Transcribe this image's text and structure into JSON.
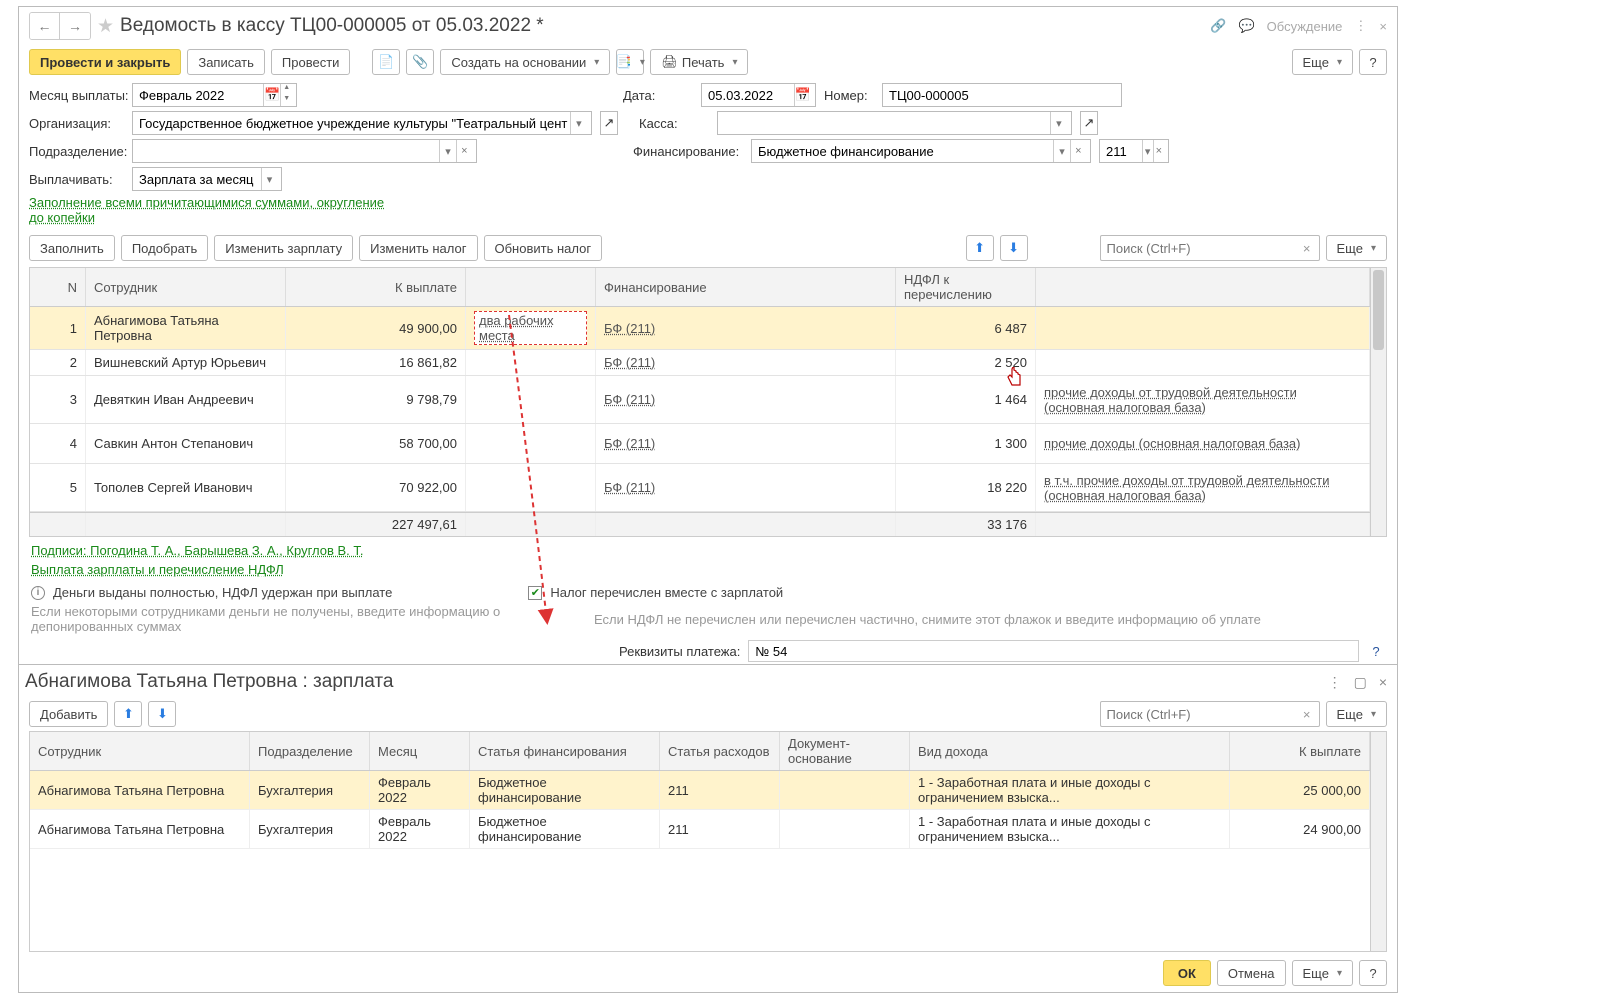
{
  "header": {
    "title": "Ведомость в кассу ТЦ00-000005 от 05.03.2022 *",
    "discussion": "Обсуждение"
  },
  "toolbar": {
    "post_close": "Провести и закрыть",
    "save": "Записать",
    "post": "Провести",
    "create_based": "Создать на основании",
    "print": "Печать",
    "more": "Еще"
  },
  "form": {
    "month_lbl": "Месяц выплаты:",
    "month_val": "Февраль 2022",
    "date_lbl": "Дата:",
    "date_val": "05.03.2022",
    "num_lbl": "Номер:",
    "num_val": "ТЦ00-000005",
    "org_lbl": "Организация:",
    "org_val": "Государственное бюджетное учреждение культуры \"Театральный центр\"",
    "cash_lbl": "Касса:",
    "cash_val": "",
    "dep_lbl": "Подразделение:",
    "dep_val": "",
    "fin_lbl": "Финансирование:",
    "fin_val": "Бюджетное финансирование",
    "fin_code": "211",
    "pay_lbl": "Выплачивать:",
    "pay_val": "Зарплата за месяц",
    "fill_link": "Заполнение всеми причитающимися суммами, округление до копейки"
  },
  "actions": {
    "fill": "Заполнить",
    "pick": "Подобрать",
    "edit_salary": "Изменить зарплату",
    "edit_tax": "Изменить налог",
    "refresh_tax": "Обновить налог",
    "search_ph": "Поиск (Ctrl+F)",
    "more": "Еще"
  },
  "table": {
    "cols": {
      "n": "N",
      "emp": "Сотрудник",
      "pay": "К выплате",
      "fin": "Финансирование",
      "tax": "НДФЛ к перечислению"
    },
    "rows": [
      {
        "n": "1",
        "emp": "Абнагимова Татьяна Петровна",
        "pay": "49 900,00",
        "pay_meta": "два рабочих места",
        "fin": "БФ (211)",
        "tax": "6 487",
        "tax_meta": ""
      },
      {
        "n": "2",
        "emp": "Вишневский Артур Юрьевич",
        "pay": "16 861,82",
        "pay_meta": "",
        "fin": "БФ (211)",
        "tax": "2 520",
        "tax_meta": ""
      },
      {
        "n": "3",
        "emp": "Девяткин Иван Андреевич",
        "pay": "9 798,79",
        "pay_meta": "",
        "fin": "БФ (211)",
        "tax": "1 464",
        "tax_meta": "прочие доходы от трудовой деятельности (основная налоговая база)"
      },
      {
        "n": "4",
        "emp": "Савкин Антон Степанович",
        "pay": "58 700,00",
        "pay_meta": "",
        "fin": "БФ (211)",
        "tax": "1 300",
        "tax_meta": "прочие доходы (основная налоговая база)"
      },
      {
        "n": "5",
        "emp": "Тополев Сергей Иванович",
        "pay": "70 922,00",
        "pay_meta": "",
        "fin": "БФ (211)",
        "tax": "18 220",
        "tax_meta": "в т.ч. прочие доходы от трудовой деятельности (основная налоговая база)"
      }
    ],
    "totals": {
      "pay": "227 497,61",
      "tax": "33 176"
    }
  },
  "footer": {
    "signers": "Подписи: Погодина Т. А., Барышева З. А., Круглов В. Т.",
    "pay_transfer": "Выплата зарплаты и перечисление НДФЛ",
    "info_text": "Деньги выданы полностью, НДФЛ удержан при выплате",
    "muted_left": "Если некоторыми сотрудниками деньги не получены, введите информацию о депонированных суммах",
    "chk_lbl": "Налог перечислен вместе с зарплатой",
    "muted_right": "Если НДФЛ не перечислен или перечислен частично, снимите этот флажок и введите информацию об уплате",
    "req_lbl": "Реквизиты платежа:",
    "req_val": "№ 54"
  },
  "sub": {
    "title": "Абнагимова Татьяна Петровна : зарплата",
    "add": "Добавить",
    "search_ph": "Поиск (Ctrl+F)",
    "more": "Еще",
    "ok": "ОК",
    "cancel": "Отмена",
    "help": "?",
    "cols": {
      "emp": "Сотрудник",
      "dep": "Подразделение",
      "mon": "Месяц",
      "fin": "Статья финансирования",
      "rash": "Статья расходов",
      "doc": "Документ-основание",
      "kind": "Вид дохода",
      "amt": "К выплате"
    },
    "rows": [
      {
        "emp": "Абнагимова Татьяна Петровна",
        "dep": "Бухгалтерия",
        "mon": "Февраль 2022",
        "fin": "Бюджетное финансирование",
        "rash": "211",
        "doc": "",
        "kind": "1 - Заработная плата и иные доходы с ограничением взыска...",
        "amt": "25 000,00"
      },
      {
        "emp": "Абнагимова Татьяна Петровна",
        "dep": "Бухгалтерия",
        "mon": "Февраль 2022",
        "fin": "Бюджетное финансирование",
        "rash": "211",
        "doc": "",
        "kind": "1 - Заработная плата и иные доходы с ограничением взыска...",
        "amt": "24 900,00"
      }
    ]
  }
}
